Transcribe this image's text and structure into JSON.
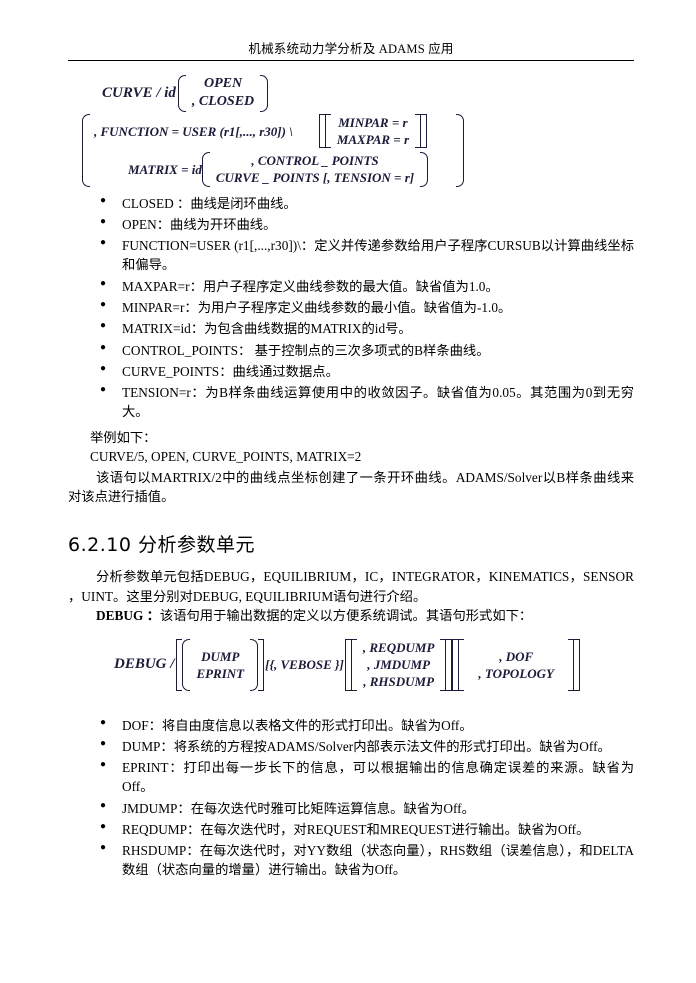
{
  "header": {
    "running_title": "机械系统动力学分析及 ADAMS 应用"
  },
  "formula_curve": {
    "lead": "CURVE / id",
    "option_open": "OPEN",
    "option_closed": ", CLOSED",
    "function_line": ", FUNCTION = USER  (r1[,..., r30]) \\",
    "minpar": "MINPAR = r",
    "maxpar": "MAXPAR = r",
    "matrix_lead": "MATRIX = id",
    "control_points": ", CONTROL _ POINTS",
    "curve_points": "CURVE _ POINTS [, TENSION = r]"
  },
  "curve_bullets": [
    "CLOSED ：曲线是闭环曲线。",
    "OPEN：曲线为开环曲线。",
    "FUNCTION=USER (r1[,...,r30])\\：定义并传递参数给用户子程序CURSUB以计算曲线坐标和偏导。",
    "MAXPAR=r：用户子程序定义曲线参数的最大值。缺省值为1.0。",
    "MINPAR=r：为用户子程序定义曲线参数的最小值。缺省值为-1.0。",
    "MATRIX=id：为包含曲线数据的MATRIX的id号。",
    "CONTROL_POINTS： 基于控制点的三次多项式的B样条曲线。",
    "CURVE_POINTS：曲线通过数据点。",
    "TENSION=r：为B样条曲线运算使用中的收敛因子。缺省值为0.05。其范围为0到无穷大。"
  ],
  "example": {
    "label": "举例如下：",
    "code": "CURVE/5, OPEN, CURVE_POINTS, MATRIX=2",
    "description": "该语句以MARTRIX/2中的曲线点坐标创建了一条开环曲线。ADAMS/Solver以B样条曲线来对该点进行插值。"
  },
  "section": {
    "heading": "6.2.10 分析参数单元",
    "intro": "分析参数单元包括DEBUG，EQUILIBRIUM，IC，INTEGRATOR，KINEMATICS，SENSOR ，UINT。这里分别对DEBUG, EQUILIBRIUM语句进行介绍。",
    "debug_label": "DEBUG ：",
    "debug_text": "该语句用于输出数据的定义以方便系统调试。其语句形式如下："
  },
  "formula_debug": {
    "lead": "DEBUG /",
    "dump": "DUMP",
    "eprint": "EPRINT",
    "vebose": "[{, VEBOSE }]",
    "reqdump": ", REQDUMP",
    "jmdump": ", JMDUMP",
    "rhsdump": ", RHSDUMP",
    "dof": ", DOF",
    "topology": ", TOPOLOGY"
  },
  "debug_bullets": [
    "DOF：将自由度信息以表格文件的形式打印出。缺省为Off。",
    "DUMP：将系统的方程按ADAMS/Solver内部表示法文件的形式打印出。缺省为Off。",
    "EPRINT：打印出每一步长下的信息，可以根据输出的信息确定误差的来源。缺省为Off。",
    "JMDUMP：在每次迭代时雅可比矩阵运算信息。缺省为Off。",
    "REQDUMP：在每次迭代时，对REQUEST和MREQUEST进行输出。缺省为Off。",
    "RHSDUMP：在每次迭代时，对YY数组（状态向量），RHS数组（误差信息），和DELTA数组（状态向量的增量）进行输出。缺省为Off。"
  ]
}
